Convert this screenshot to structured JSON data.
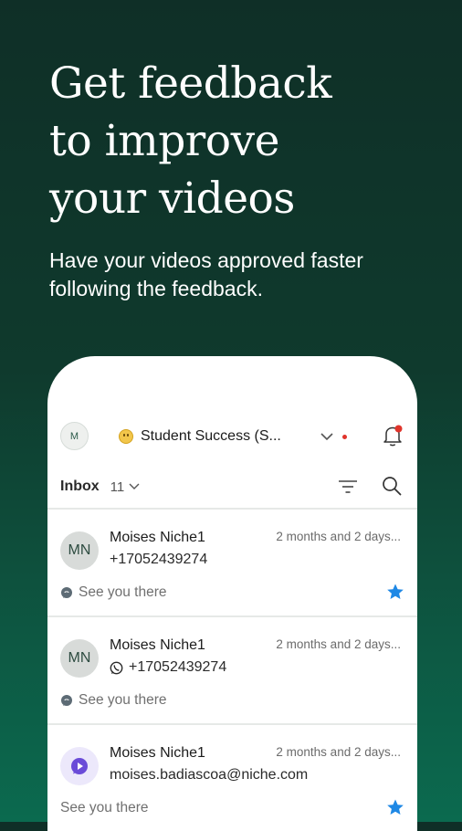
{
  "headline": [
    "Get feedback",
    "to improve",
    "your videos"
  ],
  "subtitle": [
    "Have your videos approved faster",
    "following the feedback."
  ],
  "app": {
    "avatar_initial": "M",
    "workspace_name": "Student Success (S...",
    "inbox_label": "Inbox",
    "inbox_count": "11",
    "conversations": [
      {
        "initials": "MN",
        "name": "Moises Niche1",
        "time": "2 months and 2 days...",
        "contact": "+17052439274",
        "channel_icon": "none",
        "message": "See you there",
        "message_icon": "chat-bubble-icon",
        "starred": true
      },
      {
        "initials": "MN",
        "name": "Moises Niche1",
        "time": "2 months and 2 days...",
        "contact": "+17052439274",
        "channel_icon": "whatsapp-icon",
        "message": "See you there",
        "message_icon": "chat-bubble-icon",
        "starred": false
      },
      {
        "initials": "",
        "name": "Moises Niche1",
        "time": "2 months and 2 days...",
        "contact": "moises.badiascoa@niche.com",
        "channel_icon": "none",
        "message": "See you there",
        "message_icon": "none",
        "starred": true
      }
    ]
  },
  "colors": {
    "background_top": "#0f2f27",
    "background_bottom": "#0b6a4f",
    "star": "#1e88e5",
    "notification_dot": "#e0342b",
    "purple_avatar": "#6a4bd8"
  }
}
